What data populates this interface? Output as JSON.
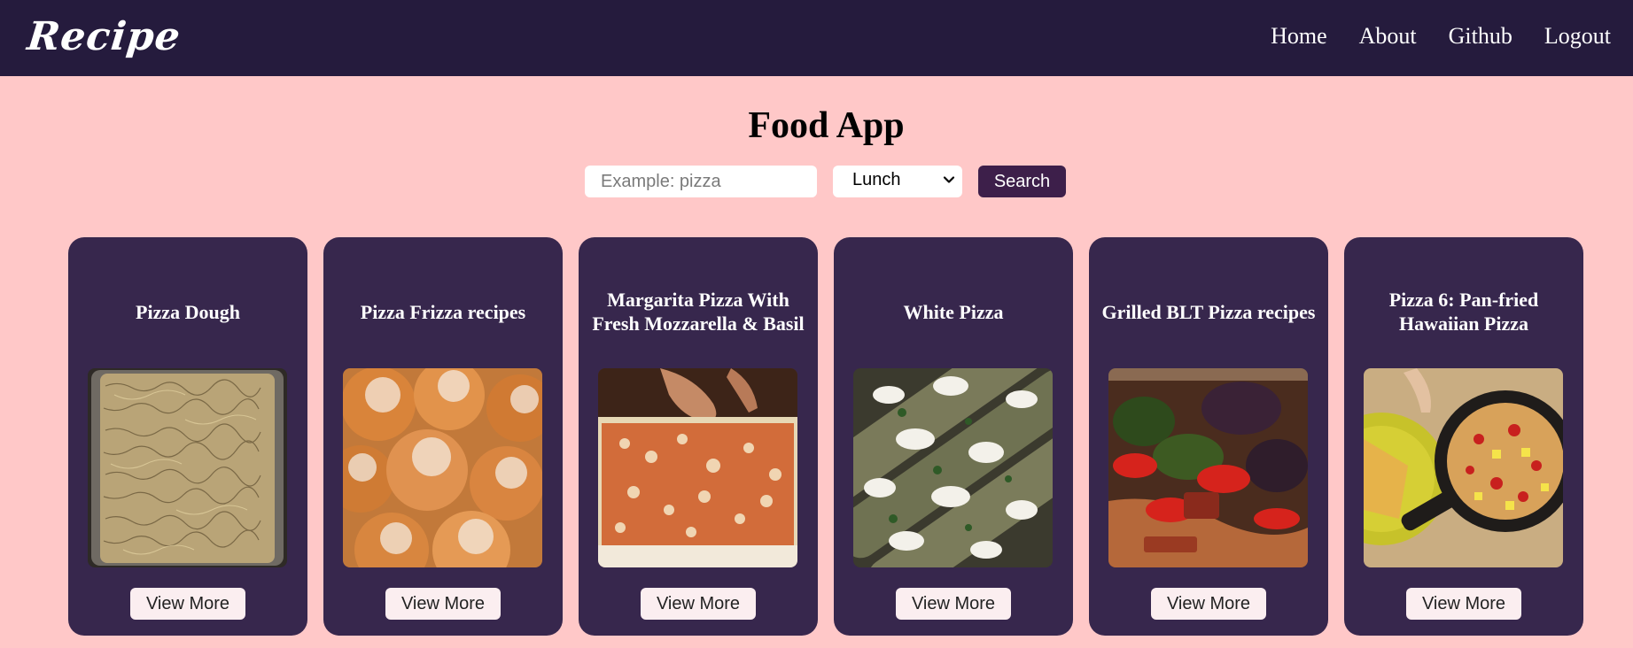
{
  "navbar": {
    "brand": "Recipe",
    "links": [
      "Home",
      "About",
      "Github",
      "Logout"
    ]
  },
  "main": {
    "title": "Food App",
    "search": {
      "placeholder": "Example: pizza",
      "value": "",
      "meal_selected": "Lunch",
      "button_label": "Search"
    }
  },
  "recipes": [
    {
      "title": "Pizza Dough",
      "image": "focaccia-dough-photo",
      "button": "View More"
    },
    {
      "title": "Pizza Frizza recipes",
      "image": "sugared-doughnut-balls-photo",
      "button": "View More"
    },
    {
      "title": "Margarita Pizza With Fresh Mozzarella & Basil",
      "image": "margarita-pizza-prep-photo",
      "button": "View More"
    },
    {
      "title": "White Pizza",
      "image": "white-pizza-slices-photo",
      "button": "View More"
    },
    {
      "title": "Grilled BLT Pizza recipes",
      "image": "blt-pizza-photo",
      "button": "View More"
    },
    {
      "title": "Pizza 6: Pan-fried Hawaiian Pizza",
      "image": "hawaiian-skillet-pizza-photo",
      "button": "View More"
    }
  ],
  "colors": {
    "page_bg": "#ffc8c8",
    "navbar_bg": "#251b3d",
    "card_bg": "#37274d",
    "search_button_bg": "#3d1f4a",
    "view_button_bg": "#fbeef0"
  }
}
